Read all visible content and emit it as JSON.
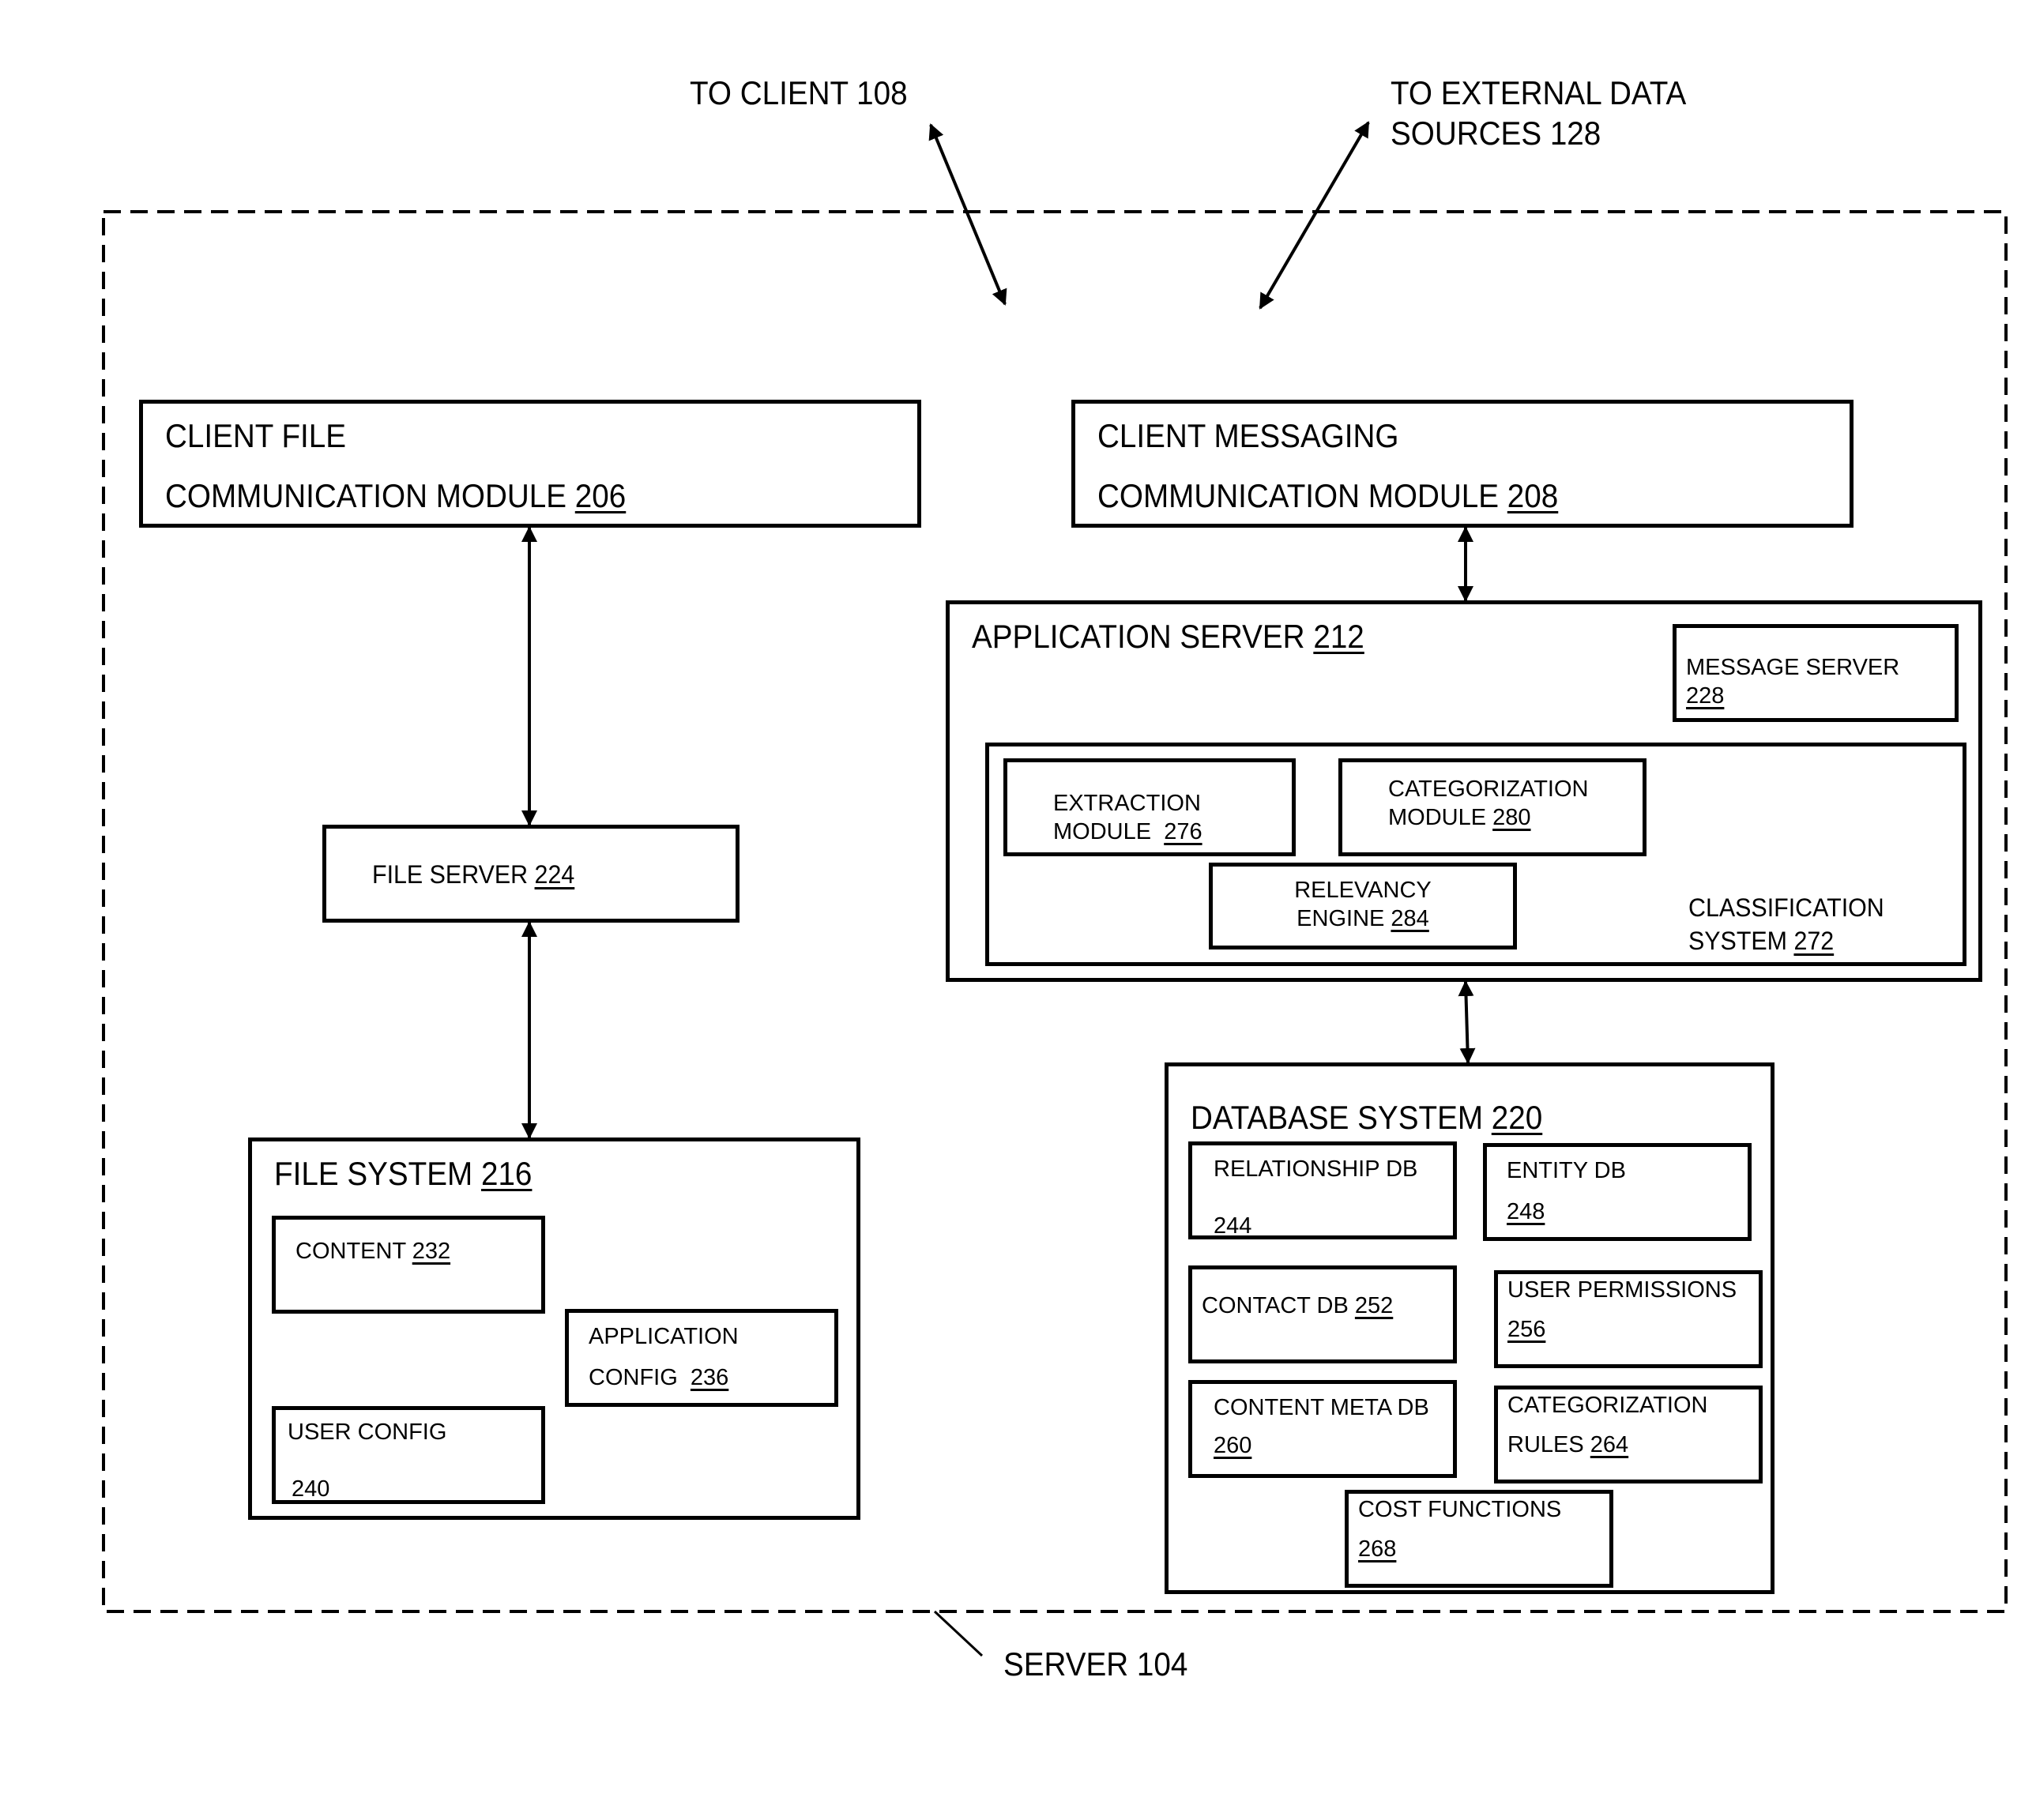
{
  "external_labels": {
    "to_client": "TO CLIENT 108",
    "to_external_line1": "TO EXTERNAL DATA",
    "to_external_line2": "SOURCES 128",
    "server": "SERVER 104"
  },
  "client_file_module": {
    "line1": "CLIENT FILE",
    "line2": "COMMUNICATION MODULE",
    "ref": "206"
  },
  "client_messaging_module": {
    "line1": "CLIENT MESSAGING",
    "line2": "COMMUNICATION MODULE",
    "ref": "208"
  },
  "file_server": {
    "label": "FILE SERVER",
    "ref": "224"
  },
  "file_system": {
    "label": "FILE SYSTEM",
    "ref": "216",
    "content": {
      "label": "CONTENT",
      "ref": "232"
    },
    "application_config": {
      "line1": "APPLICATION",
      "line2": "CONFIG",
      "ref": "236"
    },
    "user_config": {
      "label": "USER CONFIG",
      "ref": "240"
    }
  },
  "application_server": {
    "label": "APPLICATION SERVER",
    "ref": "212",
    "message_server": {
      "label": "MESSAGE SERVER",
      "ref": "228"
    },
    "classification_system": {
      "line1": "CLASSIFICATION",
      "line2": "SYSTEM",
      "ref": "272",
      "extraction_module": {
        "line1": "EXTRACTION",
        "line2": "MODULE",
        "ref": "276"
      },
      "categorization_module": {
        "line1": "CATEGORIZATION",
        "line2": "MODULE",
        "ref": "280"
      },
      "relevancy_engine": {
        "line1": "RELEVANCY",
        "line2": "ENGINE",
        "ref": "284"
      }
    }
  },
  "database_system": {
    "label": "DATABASE SYSTEM",
    "ref": "220",
    "relationship_db": {
      "label": "RELATIONSHIP DB",
      "ref": "244"
    },
    "entity_db": {
      "label": "ENTITY DB",
      "ref": "248"
    },
    "contact_db": {
      "label": "CONTACT DB",
      "ref": "252"
    },
    "user_permissions": {
      "label": "USER PERMISSIONS",
      "ref": "256"
    },
    "content_meta_db": {
      "label": "CONTENT META DB",
      "ref": "260"
    },
    "categorization_rules": {
      "line1": "CATEGORIZATION",
      "line2": "RULES",
      "ref": "264"
    },
    "cost_functions": {
      "label": "COST FUNCTIONS",
      "ref": "268"
    }
  }
}
